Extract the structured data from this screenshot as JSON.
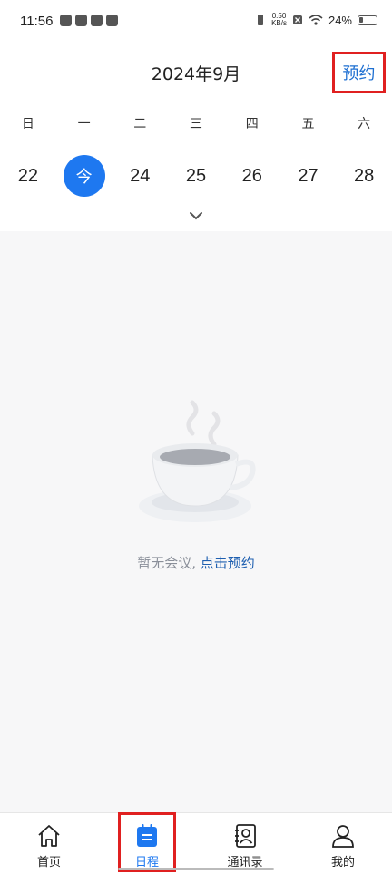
{
  "status_bar": {
    "time": "11:56",
    "speed_value": "0.50",
    "speed_unit": "KB/s",
    "battery": "24%"
  },
  "header": {
    "month_title": "2024年9月",
    "book_label": "预约"
  },
  "calendar": {
    "weekdays": [
      "日",
      "一",
      "二",
      "三",
      "四",
      "五",
      "六"
    ],
    "dates": [
      "22",
      "今",
      "24",
      "25",
      "26",
      "27",
      "28"
    ],
    "today_index": 1,
    "today_color": "#1e78f0"
  },
  "empty_state": {
    "message": "暂无会议, ",
    "link": "点击预约"
  },
  "tabs": [
    {
      "label": "首页",
      "icon": "home-icon"
    },
    {
      "label": "日程",
      "icon": "calendar-icon",
      "active": true
    },
    {
      "label": "通讯录",
      "icon": "contacts-icon"
    },
    {
      "label": "我的",
      "icon": "profile-icon"
    }
  ]
}
